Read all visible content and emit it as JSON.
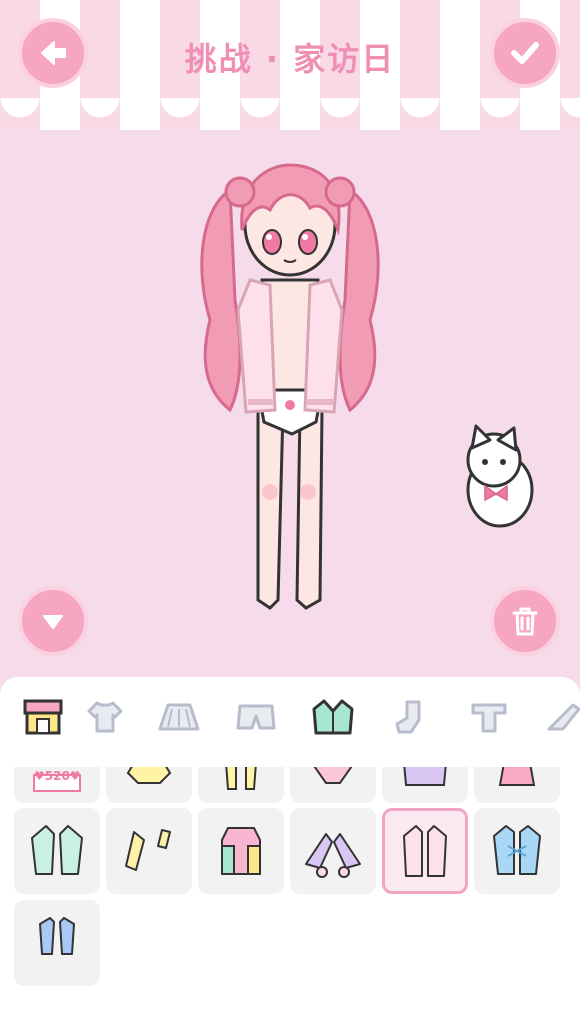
{
  "header": {
    "title": "挑战 · 家访日"
  },
  "colors": {
    "accent_pink": "#f6a6c2",
    "title_pink": "#f08fb3",
    "stage_bg": "#f6dcea",
    "selected_border": "#f3a4c2"
  },
  "buttons": {
    "back": "arrow-left-icon",
    "confirm": "check-icon",
    "collapse": "triangle-down-icon",
    "delete": "trash-icon"
  },
  "tabs": [
    {
      "name": "shop",
      "icon": "shop-icon",
      "active": false
    },
    {
      "name": "tops",
      "icon": "tshirt-icon",
      "active": false
    },
    {
      "name": "skirts",
      "icon": "skirt-icon",
      "active": false
    },
    {
      "name": "shorts",
      "icon": "shorts-icon",
      "active": false
    },
    {
      "name": "jackets",
      "icon": "jacket-icon",
      "active": true
    },
    {
      "name": "socks",
      "icon": "sock-icon",
      "active": false
    },
    {
      "name": "innerwear",
      "icon": "shirt-t-icon",
      "active": false
    },
    {
      "name": "shoes",
      "icon": "heel-icon",
      "active": false
    }
  ],
  "items": {
    "row_partial": [
      "dress-520",
      "yellow-hoodie",
      "yellow-sleeves",
      "pink-bow-cardigan",
      "lavender-jacket",
      "pink-frill-dress"
    ],
    "badge": "♥520♥",
    "row2": [
      "mint-jacket",
      "yellow-bolero",
      "pastel-hoodie",
      "lavender-capelet",
      "pink-cardigan",
      "blue-laceup-jacket"
    ],
    "row3": [
      "blue-vest"
    ],
    "selected": "pink-cardigan"
  }
}
